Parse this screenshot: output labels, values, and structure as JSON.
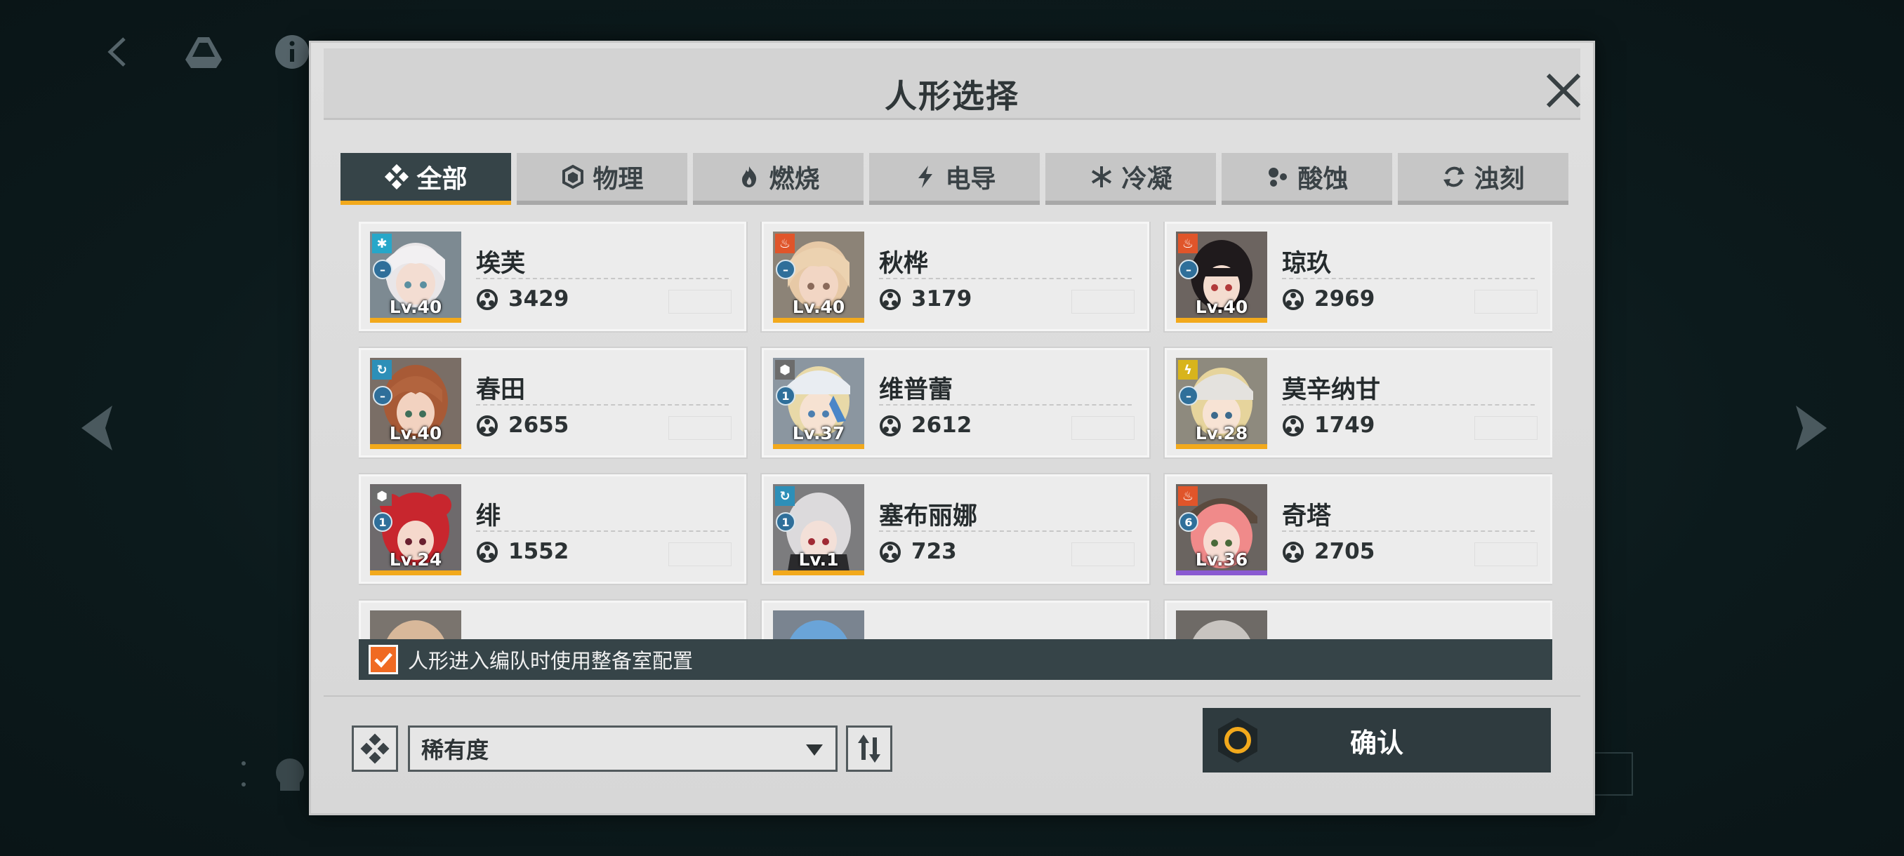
{
  "dialog": {
    "title": "人形选择"
  },
  "tabs": [
    {
      "label": "全部",
      "icon": "diamond-grid-icon",
      "active": true
    },
    {
      "label": "物理",
      "icon": "hexagon-icon",
      "active": false
    },
    {
      "label": "燃烧",
      "icon": "flame-icon",
      "active": false
    },
    {
      "label": "电导",
      "icon": "lightning-icon",
      "active": false
    },
    {
      "label": "冷凝",
      "icon": "snowflake-icon",
      "active": false
    },
    {
      "label": "酸蚀",
      "icon": "acid-dots-icon",
      "active": false
    },
    {
      "label": "浊刻",
      "icon": "swirl-icon",
      "active": false
    }
  ],
  "dolls": [
    {
      "name": "埃芙",
      "level": "Lv.40",
      "power": "3429",
      "element": "snowflake-icon",
      "rank": "–"
    },
    {
      "name": "秋桦",
      "level": "Lv.40",
      "power": "3179",
      "element": "flame-icon",
      "rank": "–"
    },
    {
      "name": "琼玖",
      "level": "Lv.40",
      "power": "2969",
      "element": "flame-icon",
      "rank": "–"
    },
    {
      "name": "春田",
      "level": "Lv.40",
      "power": "2655",
      "element": "swirl-icon",
      "rank": "–"
    },
    {
      "name": "维普蕾",
      "level": "Lv.37",
      "power": "2612",
      "element": "hexagon-icon",
      "rank": "1"
    },
    {
      "name": "莫辛纳甘",
      "level": "Lv.28",
      "power": "1749",
      "element": "lightning-icon",
      "rank": "–"
    },
    {
      "name": "绯",
      "level": "Lv.24",
      "power": "1552",
      "element": "hexagon-icon",
      "rank": "1"
    },
    {
      "name": "塞布丽娜",
      "level": "Lv.1",
      "power": "723",
      "element": "swirl-icon",
      "rank": "1"
    },
    {
      "name": "奇塔",
      "level": "Lv.36",
      "power": "2705",
      "element": "flame-icon",
      "rank": "6"
    }
  ],
  "config": {
    "checkbox_label": "人形进入编队时使用整备室配置",
    "checked": true
  },
  "sort": {
    "selected": "稀有度"
  },
  "confirm": {
    "label": "确认"
  },
  "colors": {
    "accent_orange": "#f06a22",
    "accent_gold": "#f2a91c",
    "dark_panel": "#364448",
    "ssr_purple": "#8a5ad1"
  }
}
